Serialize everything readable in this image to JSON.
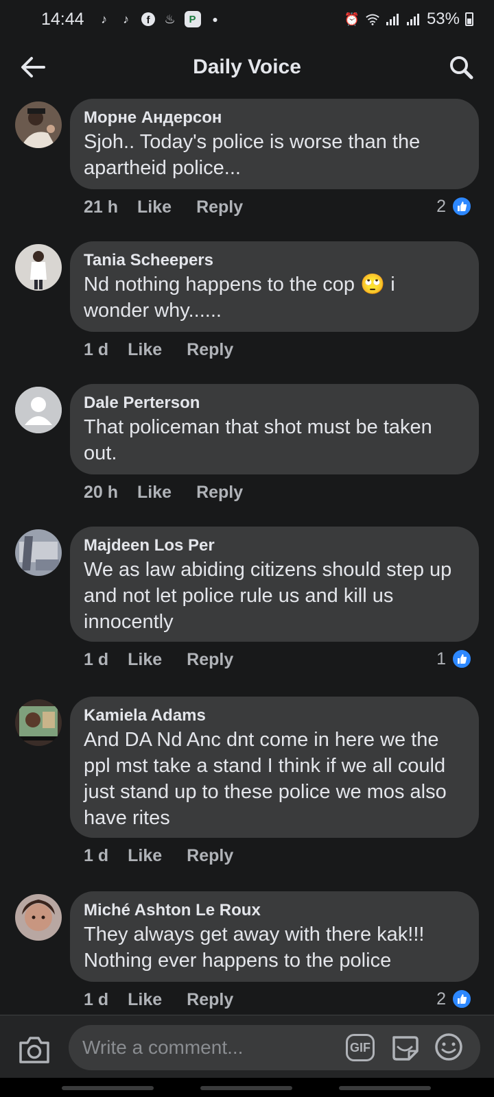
{
  "status_bar": {
    "time": "14:44",
    "battery": "53%",
    "badge_letter": "P"
  },
  "header": {
    "title": "Daily Voice"
  },
  "comments": [
    {
      "author": "Морне Андерсон",
      "text": "Sjoh.. Today's police is worse than the apartheid police...",
      "time": "21 h",
      "like_label": "Like",
      "reply_label": "Reply",
      "reaction_count": "2"
    },
    {
      "author": "Tania Scheepers",
      "text": "Nd nothing happens to the cop 🙄 i wonder why......",
      "time": "1 d",
      "like_label": "Like",
      "reply_label": "Reply",
      "reaction_count": ""
    },
    {
      "author": "Dale Perterson",
      "text": "That policeman that shot must be taken out.",
      "time": "20 h",
      "like_label": "Like",
      "reply_label": "Reply",
      "reaction_count": ""
    },
    {
      "author": "Majdeen Los Per",
      "text": "We as law abiding citizens should step up and not let police rule us and kill us innocently",
      "time": "1 d",
      "like_label": "Like",
      "reply_label": "Reply",
      "reaction_count": "1"
    },
    {
      "author": "Kamiela Adams",
      "text": "And DA Nd Anc dnt come in here we the ppl mst take a stand I think if we all could just stand up to these police we mos also have rites",
      "time": "1 d",
      "like_label": "Like",
      "reply_label": "Reply",
      "reaction_count": ""
    },
    {
      "author": "Miché Ashton Le Roux",
      "text": "They always get away with there kak!!! Nothing ever happens to the police",
      "time": "1 d",
      "like_label": "Like",
      "reply_label": "Reply",
      "reaction_count": "2"
    }
  ],
  "composer": {
    "placeholder": "Write a comment...",
    "gif_label": "GIF"
  },
  "colors": {
    "background": "#18191a",
    "bubble": "#3a3b3c",
    "like_blue": "#2d88ff"
  }
}
